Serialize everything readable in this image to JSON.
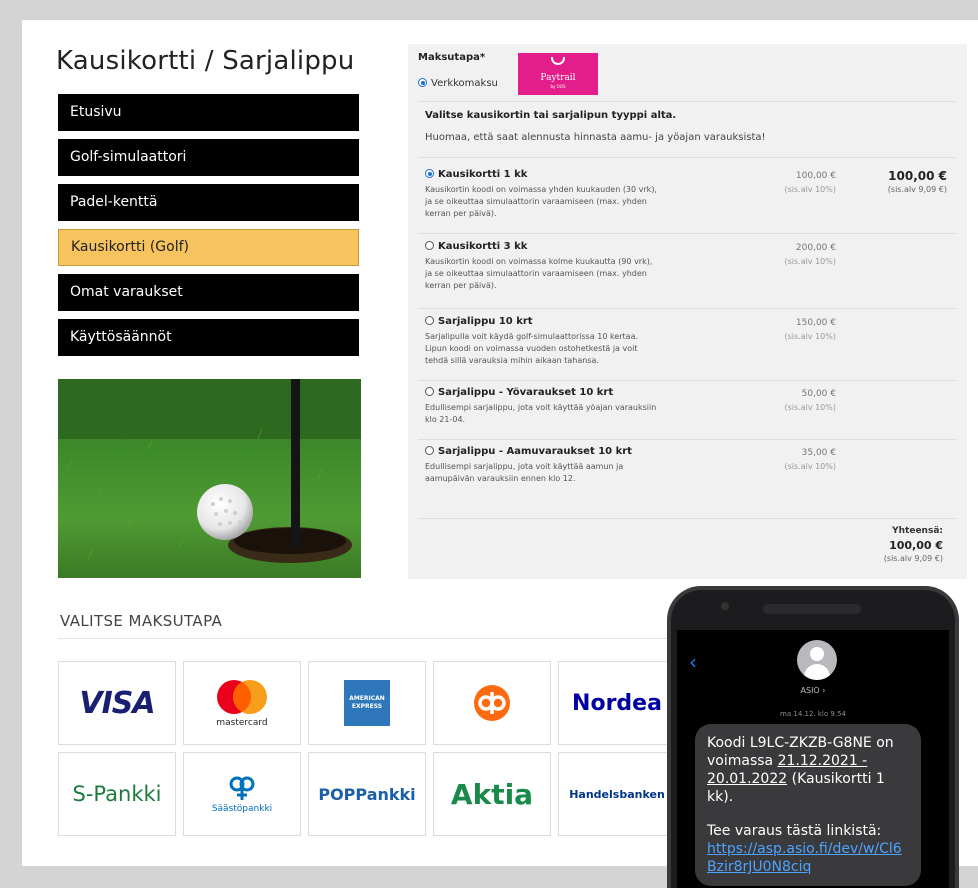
{
  "site": {
    "title": "Kausikortti / Sarjalippu"
  },
  "nav": [
    {
      "label": "Etusivu",
      "active": false
    },
    {
      "label": "Golf-simulaattori",
      "active": false
    },
    {
      "label": "Padel-kenttä",
      "active": false
    },
    {
      "label": "Kausikortti (Golf)",
      "active": true
    },
    {
      "label": "Omat varaukset",
      "active": false
    },
    {
      "label": "Käyttösäännöt",
      "active": false
    }
  ],
  "payment_method": {
    "label": "Maksutapa*",
    "option": "Verkkomaksu",
    "provider_name": "Paytrail",
    "provider_sub": "by OOS"
  },
  "intro": {
    "title": "Valitse kausikortin tai sarjalipun tyyppi alta.",
    "note": "Huomaa, että saat alennusta hinnasta aamu- ja yöajan varauksista!"
  },
  "products": [
    {
      "name": "Kausikortti 1 kk",
      "desc": "Kausikortin koodi on voimassa yhden kuukauden (30 vrk), ja se oikeuttaa simulaattorin varaamiseen (max. yhden kerran per päivä).",
      "price": "100,00 €",
      "vat": "(sis.alv 10%)",
      "selected": true,
      "sel_price": "100,00 €",
      "sel_vat": "(sis.alv 9,09 €)"
    },
    {
      "name": "Kausikortti 3 kk",
      "desc": "Kausikortin koodi on voimassa kolme kuukautta (90 vrk), ja se oikeuttaa simulaattorin varaamiseen (max. yhden kerran per päivä).",
      "price": "200,00 €",
      "vat": "(sis.alv 10%)",
      "selected": false
    },
    {
      "name": "Sarjalippu 10 krt",
      "desc": "Sarjalipulla voit käydä golf-simulaattorissa 10 kertaa. Lipun koodi on voimassa vuoden ostohetkestä ja voit tehdä sillä varauksia mihin aikaan tahansa.",
      "price": "150,00 €",
      "vat": "(sis.alv 10%)",
      "selected": false
    },
    {
      "name": "Sarjalippu - Yövaraukset 10 krt",
      "desc": "Edullisempi sarjalippu, jota voit käyttää yöajan varauksiin klo 21-04.",
      "price": "50,00 €",
      "vat": "(sis.alv 10%)",
      "selected": false
    },
    {
      "name": "Sarjalippu - Aamuvaraukset 10 krt",
      "desc": "Edullisempi sarjalippu, jota voit käyttää aamun ja aamupäivän varauksiin ennen klo 12.",
      "price": "35,00 €",
      "vat": "(sis.alv 10%)",
      "selected": false
    }
  ],
  "total": {
    "label": "Yhteensä:",
    "amount": "100,00 €",
    "vat": "(sis.alv 9,09 €)"
  },
  "payment_section": {
    "title": "VALITSE MAKSUTAPA"
  },
  "banks": [
    {
      "label": "VISA",
      "color": "#1a1f71"
    },
    {
      "label": "mastercard",
      "color": "#231f20"
    },
    {
      "label": "AMERICAN EXPRESS",
      "color": "#ffffff"
    },
    {
      "label": "",
      "color": "#ff6a10"
    },
    {
      "label": "Nordea",
      "color": "#0000a0"
    },
    {
      "label": "S-Pankki",
      "color": "#1c7a3d"
    },
    {
      "label": "Säästöpankki",
      "color": "#0071bc"
    },
    {
      "label": "POPPankki",
      "color": "#1b5fa8"
    },
    {
      "label": "Aktia",
      "color": "#1a8a4a"
    },
    {
      "label": "Handelsbanken",
      "color": "#00348a"
    }
  ],
  "sms": {
    "contact": "ASIO ›",
    "time": "ma 14.12. klo 9.54",
    "text_a": "Koodi L9LC-ZKZB-G8NE on voimassa ",
    "text_b": "21.12.2021 - 20.01.2022",
    "text_c": " (Kausikortti 1 kk).",
    "text_d": "Tee varaus tästä linkistä:",
    "link": "https://asp.asio.fi/dev/w/Cl6Bzir8rJU0N8ciq"
  }
}
